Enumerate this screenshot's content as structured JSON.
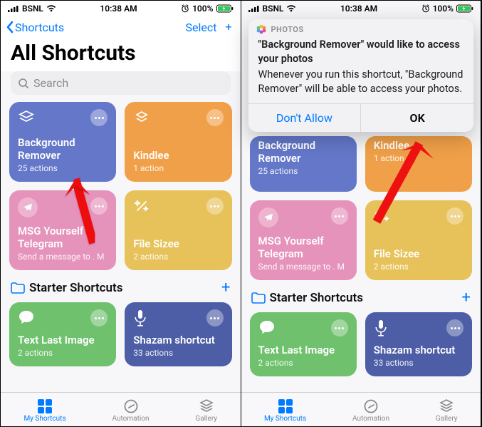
{
  "status": {
    "carrier": "BSNL",
    "time": "10:38 AM",
    "battery": "100%"
  },
  "nav": {
    "back": "Shortcuts",
    "select": "Select"
  },
  "title": "All Shortcuts",
  "search": {
    "placeholder": "Search"
  },
  "cards": {
    "bg": {
      "title": "Background Remover",
      "sub": "25 actions"
    },
    "kind": {
      "title": "Kindlee",
      "sub": "1 action"
    },
    "msg": {
      "title": "MSG Yourself Telegram",
      "sub": "Send a message to . M"
    },
    "file": {
      "title": "File Sizee",
      "sub": "2 actions"
    },
    "text": {
      "title": "Text Last Image",
      "sub": "2 actions"
    },
    "shaz": {
      "title": "Shazam shortcut",
      "sub": "33 actions"
    }
  },
  "section": {
    "label": "Starter Shortcuts"
  },
  "tabs": {
    "my": "My Shortcuts",
    "auto": "Automation",
    "gal": "Gallery"
  },
  "dialog": {
    "app": "PHOTOS",
    "title": "\"Background Remover\" would like to access your photos",
    "body": "Whenever you run this shortcut, \"Background Remover\" will be able to access your photos.",
    "deny": "Don't Allow",
    "allow": "OK"
  }
}
